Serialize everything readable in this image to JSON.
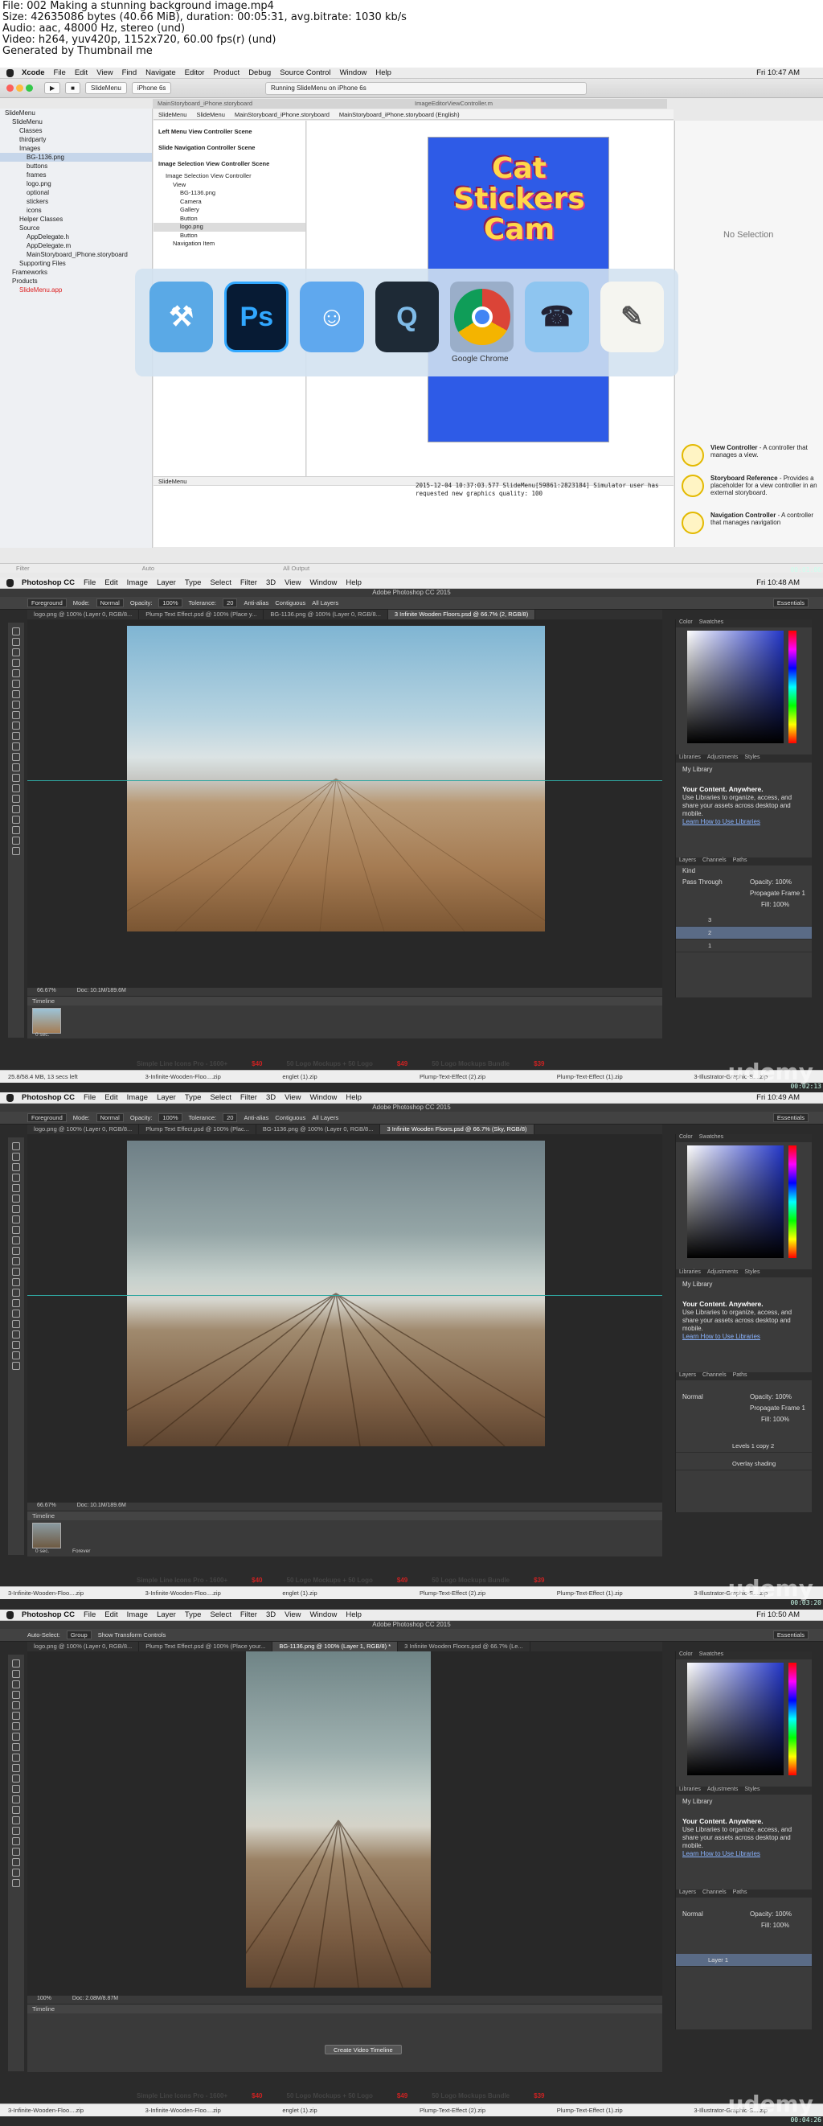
{
  "file_info": [
    "File: 002 Making a stunning background image.mp4",
    "Size: 42635086 bytes (40.66 MiB), duration: 00:05:31, avg.bitrate: 1030 kb/s",
    "Audio: aac, 48000 Hz, stereo (und)",
    "Video: h264, yuv420p, 1152x720, 60.00 fps(r) (und)",
    "Generated by Thumbnail me"
  ],
  "xcode": {
    "menu": [
      "Xcode",
      "File",
      "Edit",
      "View",
      "Find",
      "Navigate",
      "Editor",
      "Product",
      "Debug",
      "Source Control",
      "Window",
      "Help"
    ],
    "clock": "Fri 10:47 AM",
    "scheme": "SlideMenu",
    "device": "iPhone 6s",
    "status": "Running SlideMenu on iPhone 6s",
    "tab_storyboard": "MainStoryboard_iPhone.storyboard",
    "tab_editor": "ImageEditorViewController.m",
    "breadcrumb": [
      "SlideMenu",
      "SlideMenu",
      "MainStoryboard_iPhone.storyboard",
      "MainStoryboard_iPhone.storyboard (English)"
    ],
    "navigator": [
      "SlideMenu",
      "SlideMenu",
      "Classes",
      "thirdparty",
      "Images",
      "BG-1136.png",
      "buttons",
      "frames",
      "logo.png",
      "optional",
      "stickers",
      "icons",
      "Helper Classes",
      "Source",
      "AppDelegate.h",
      "AppDelegate.m",
      "MainStoryboard_iPhone.storyboard",
      "Supporting Files",
      "Frameworks",
      "Products",
      "SlideMenu.app"
    ],
    "scenes": [
      "Left Menu View Controller Scene",
      "Slide Navigation Controller Scene",
      "Image Selection View Controller Scene",
      "Image Selection View Controller",
      "View",
      "BG-1136.png",
      "Camera",
      "Gallery",
      "Button",
      "logo.png",
      "Button",
      "Navigation Item"
    ],
    "phone_title": "Cat Stickers Cam",
    "no_selection": "No Selection",
    "library": [
      {
        "title": "View Controller",
        "desc": "- A controller that manages a view."
      },
      {
        "title": "Storyboard Reference",
        "desc": "- Provides a placeholder for a view controller in an external storyboard."
      },
      {
        "title": "Navigation Controller",
        "desc": "- A controller that manages navigation"
      }
    ],
    "log": "2015-12-04 10:37:03.577 SlideMenu[59861:2823184] Simulator user has requested new graphics quality: 100",
    "debug_target": "SlideMenu",
    "filter_placeholder": "Filter",
    "output": "All Output",
    "auto": "Auto",
    "dock_label": "Google Chrome",
    "timecode": "00:01:06"
  },
  "ps_common": {
    "menu": [
      "Photoshop CC",
      "File",
      "Edit",
      "Image",
      "Layer",
      "Type",
      "Select",
      "Filter",
      "3D",
      "View",
      "Window",
      "Help"
    ],
    "title": "Adobe Photoshop CC 2015",
    "essentials": "Essentials",
    "panel_tabs_color": [
      "Color",
      "Swatches"
    ],
    "panel_tabs_lib": [
      "Libraries",
      "Adjustments",
      "Styles"
    ],
    "panel_tabs_layers": [
      "Layers",
      "Channels",
      "Paths"
    ],
    "my_library": "My Library",
    "lib_heading": "Your Content. Anywhere.",
    "lib_body": "Use Libraries to organize, access, and share your assets across desktop and mobile.",
    "lib_link": "Learn How to Use Libraries",
    "downloads": [
      "3-Infinite-Wooden-Floo....zip",
      "3-Infinite-Wooden-Floo....zip",
      "englet (1).zip",
      "Plump-Text-Effect (2).zip",
      "Plump-Text-Effect (1).zip",
      "3-Illustrator-Graphic-S....zip"
    ],
    "ads": [
      "Simple Line Icons Pro - 1600+",
      "$40",
      "50 Logo Mockups + 50 Logo",
      "$49",
      "50 Logo Mockups Bundle",
      "$39"
    ],
    "udemy": "udemy"
  },
  "ps2": {
    "clock": "Fri 10:48 AM",
    "tool_opts": [
      "Foreground",
      "Mode:",
      "Normal",
      "Opacity:",
      "100%",
      "Tolerance:",
      "20",
      "Anti-alias",
      "Contiguous",
      "All Layers"
    ],
    "tabs": [
      "logo.png @ 100% (Layer 0, RGB/8...",
      "Plump Text Effect.psd @ 100% (Place y...",
      "BG-1136.png @ 100% (Layer 0, RGB/8...",
      "3 Infinite Wooden Floors.psd @ 66.7% (2, RGB/8)"
    ],
    "zoom": "66.67%",
    "doc": "Doc: 10.1M/189.6M",
    "timeline": "Timeline",
    "frame_time": "0 sec.",
    "kind": "Kind",
    "blend": "Pass Through",
    "opacity": "Opacity: 100%",
    "fill": "Fill: 100%",
    "propagate": "Propagate Frame 1",
    "layers": [
      "3",
      "2",
      "1"
    ],
    "dl_status": "25.8/58.4 MB, 13 secs left",
    "timecode": "00:02:13"
  },
  "ps3": {
    "clock": "Fri 10:49 AM",
    "tool_opts": [
      "Foreground",
      "Mode:",
      "Normal",
      "Opacity:",
      "100%",
      "Tolerance:",
      "20",
      "Anti-alias",
      "Contiguous",
      "All Layers"
    ],
    "tabs": [
      "logo.png @ 100% (Layer 0, RGB/8...",
      "Plump Text Effect.psd @ 100% (Plac...",
      "BG-1136.png @ 100% (Layer 0, RGB/8...",
      "3 Infinite Wooden Floors.psd @ 66.7% (Sky, RGB/8)"
    ],
    "zoom": "66.67%",
    "doc": "Doc: 10.1M/189.6M",
    "timeline": "Timeline",
    "frame_time": "0 sec.",
    "loop": "Forever",
    "blend": "Normal",
    "opacity": "Opacity: 100%",
    "fill": "Fill: 100%",
    "propagate": "Propagate Frame 1",
    "layers": [
      "Levels 1 copy 2",
      "Overlay shading"
    ],
    "timecode": "00:03:20"
  },
  "ps4": {
    "clock": "Fri 10:50 AM",
    "tool_opts": [
      "Auto-Select:",
      "Group",
      "Show Transform Controls"
    ],
    "tabs": [
      "logo.png @ 100% (Layer 0, RGB/8...",
      "Plump Text Effect.psd @ 100% (Place your...",
      "BG-1136.png @ 100% (Layer 1, RGB/8) *",
      "3 Infinite Wooden Floors.psd @ 66.7% (Le..."
    ],
    "zoom": "100%",
    "doc": "Doc: 2.08M/8.87M",
    "timeline": "Timeline",
    "create_timeline": "Create Video Timeline",
    "blend": "Normal",
    "opacity": "Opacity: 100%",
    "fill": "Fill: 100%",
    "layers": [
      "Layer 1"
    ],
    "timecode": "00:04:26"
  }
}
